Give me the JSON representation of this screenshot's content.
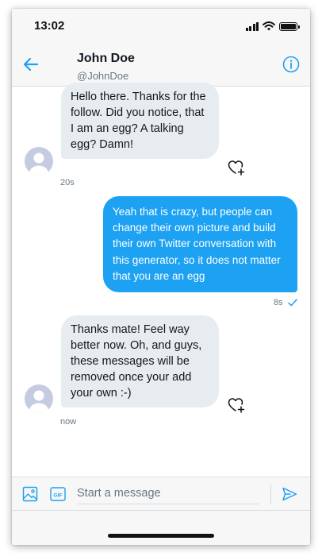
{
  "status_bar": {
    "time": "13:02",
    "icons": [
      "signal-icon",
      "wifi-icon",
      "battery-icon"
    ]
  },
  "header": {
    "name": "John Doe",
    "handle": "@JohnDoe",
    "back_icon": "arrow-left-icon",
    "info_icon": "info-icon"
  },
  "messages": [
    {
      "direction": "incoming",
      "text": "Hello there. Thanks for the follow. Did you notice, that I am an egg? A talking egg? Damn!",
      "time": "20s"
    },
    {
      "direction": "outgoing",
      "text": "Yeah that is crazy, but people can change their own picture and build their own Twitter conversation with this generator, so it does not matter that you are an egg",
      "time": "8s",
      "read": true
    },
    {
      "direction": "incoming",
      "text": "Thanks mate! Feel way better now. Oh, and guys, these messages will be removed once your add your own :-)",
      "time": "now"
    }
  ],
  "composer": {
    "placeholder": "Start a message",
    "value": "",
    "media_icon": "image-icon",
    "gif_icon": "gif-icon",
    "send_icon": "send-icon"
  },
  "colors": {
    "accent": "#1da1f2",
    "incoming_bubble": "#e6ecf0",
    "secondary_text": "#657786",
    "avatar": "#c5cbe0"
  }
}
